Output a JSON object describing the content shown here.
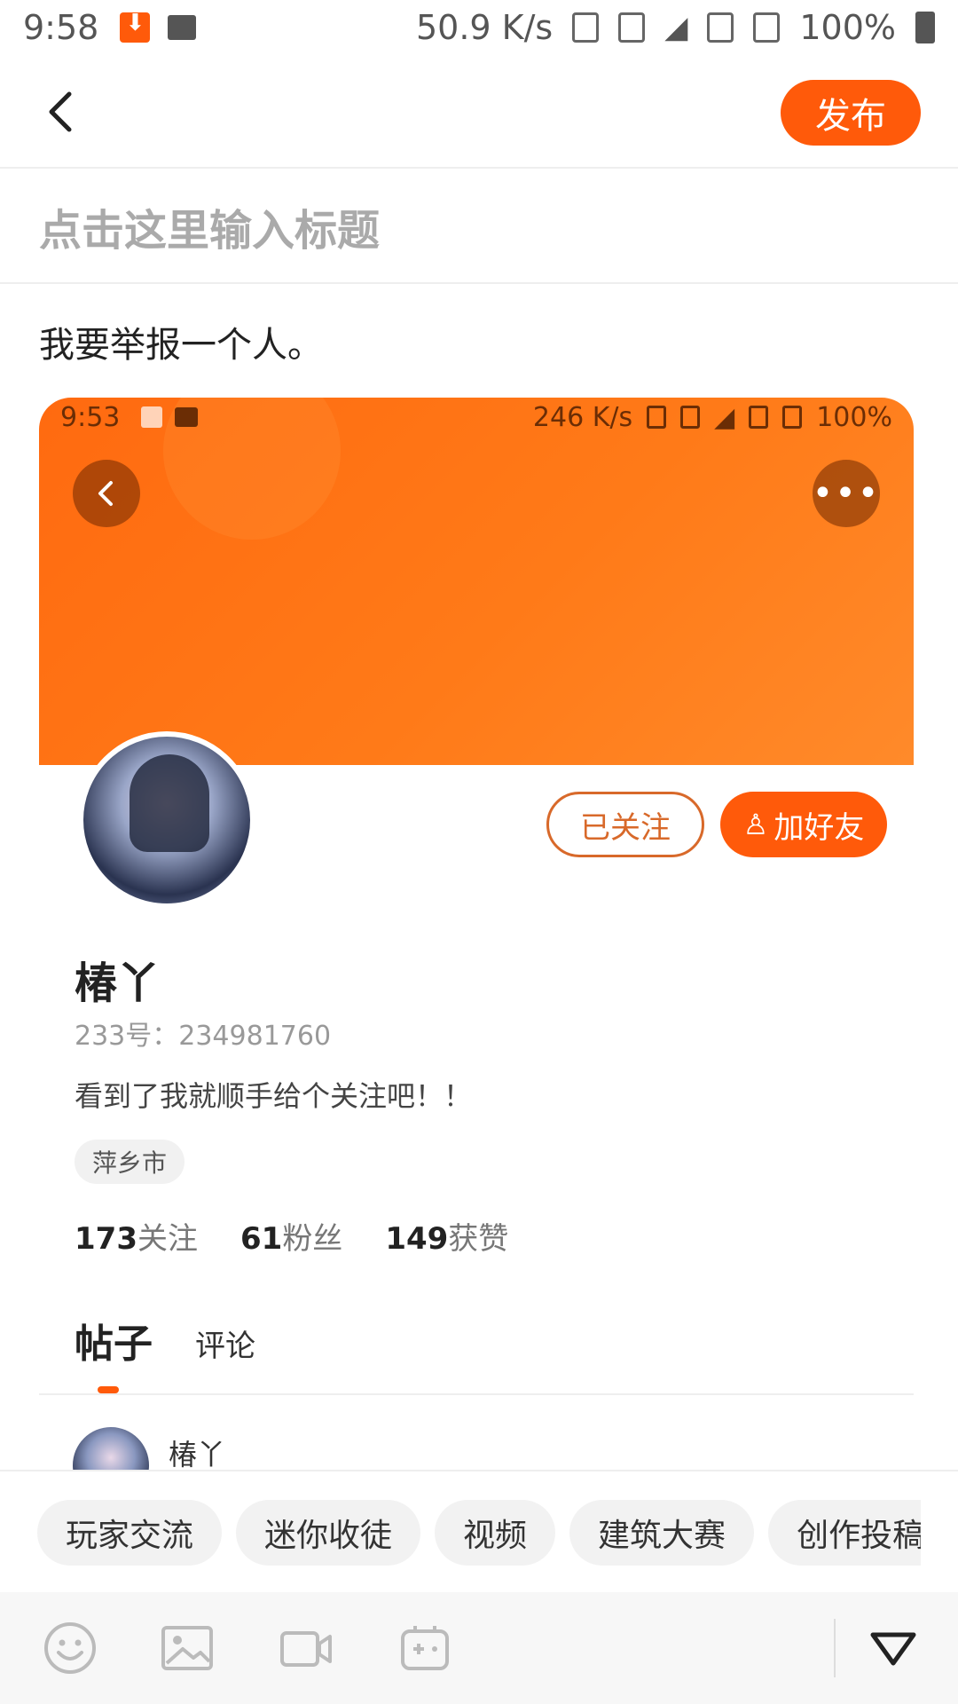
{
  "status_bar": {
    "time": "9:58",
    "speed": "50.9 K/s",
    "battery": "100%"
  },
  "header": {
    "publish_label": "发布"
  },
  "editor": {
    "title_placeholder": "点击这里输入标题",
    "body_text": "我要举报一个人。"
  },
  "embedded_screenshot": {
    "status": {
      "time": "9:53",
      "speed": "246 K/s",
      "battery": "100%"
    },
    "more_icon": "•••",
    "followed_label": "已关注",
    "add_friend_label": "加好友",
    "username": "椿丫",
    "user_id": "233号：234981760",
    "bio": "看到了我就顺手给个关注吧！！",
    "city_tag": "萍乡市",
    "stats": [
      {
        "count": "173",
        "label": "关注"
      },
      {
        "count": "61",
        "label": "粉丝"
      },
      {
        "count": "149",
        "label": "获赞"
      }
    ],
    "tabs": [
      {
        "label": "帖子"
      },
      {
        "label": "评论"
      }
    ],
    "post_author": "椿丫"
  },
  "topic_chips": [
    "玩家交流",
    "迷你收徒",
    "视频",
    "建筑大赛",
    "创作投稿"
  ],
  "toolbar_icons": [
    "emoji-icon",
    "image-icon",
    "video-icon",
    "game-controller-icon",
    "collapse-triangle-icon"
  ],
  "colors": {
    "accent": "#ff5a0a",
    "banner": "#ff7a18"
  }
}
